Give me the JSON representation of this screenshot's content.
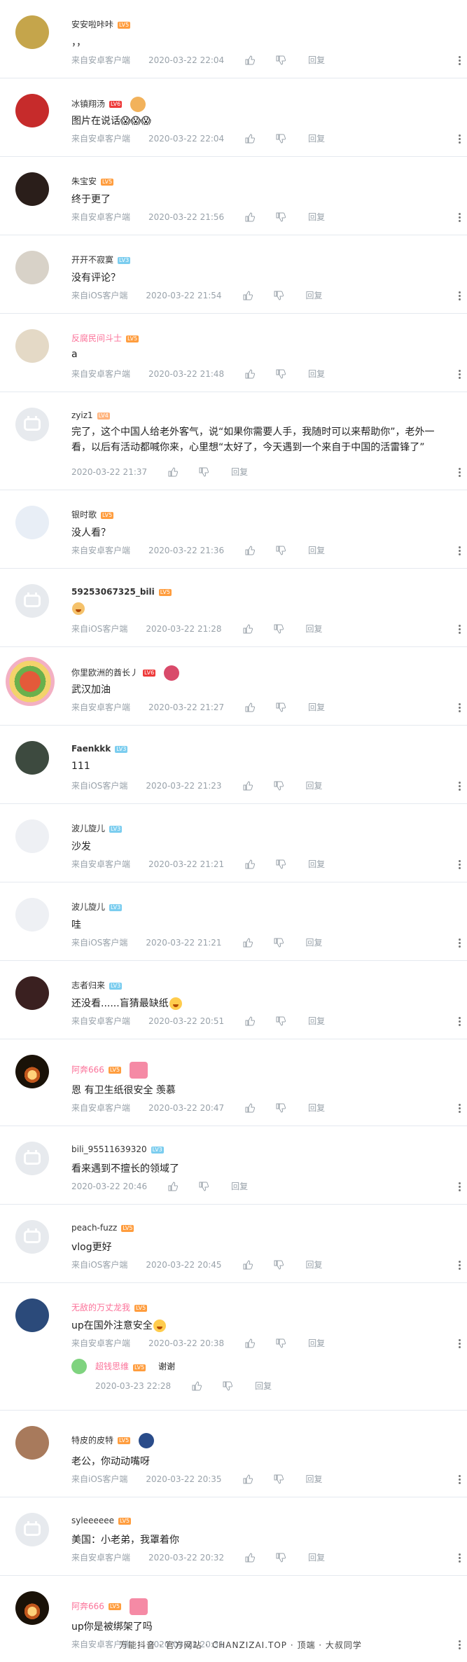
{
  "labels": {
    "reply": "回复"
  },
  "comments": [
    {
      "user": "安安啦咔咔",
      "level": "LV5",
      "text": "，，",
      "source": "来自安卓客户端",
      "time": "2020-03-22 22:04"
    },
    {
      "user": "冰镇翔汤",
      "level": "LV6",
      "text": "图片在说话😱😱😱",
      "source": "来自安卓客户端",
      "time": "2020-03-22 22:04"
    },
    {
      "user": "朱宝安",
      "level": "LV5",
      "text": "终于更了",
      "source": "来自安卓客户端",
      "time": "2020-03-22 21:56"
    },
    {
      "user": "开开不寂寞",
      "level": "LV3",
      "text": "没有评论？",
      "source": "来自iOS客户端",
      "time": "2020-03-22 21:54"
    },
    {
      "user": "反腐民间斗士",
      "level": "LV5",
      "text": "a",
      "source": "来自安卓客户端",
      "time": "2020-03-22 21:48"
    },
    {
      "user": "zyiz1",
      "level": "LV4",
      "text": "完了，这个中国人给老外客气，说“如果你需要人手，我随时可以来帮助你”，老外一看，以后有活动都喊你来，心里想“太好了，今天遇到一个来自于中国的活雷锋了”",
      "source": "",
      "time": "2020-03-22 21:37"
    },
    {
      "user": "银时歌",
      "level": "LV5",
      "text": "没人看？",
      "source": "来自安卓客户端",
      "time": "2020-03-22 21:36"
    },
    {
      "user": "59253067325_bili",
      "level": "LV5",
      "text": "",
      "source": "来自iOS客户端",
      "time": "2020-03-22 21:28"
    },
    {
      "user": "你里欧洲的酋长丿",
      "level": "LV6",
      "text": "武汉加油",
      "source": "来自安卓客户端",
      "time": "2020-03-22 21:27"
    },
    {
      "user": "Faenkkk",
      "level": "LV3",
      "text": "111",
      "source": "来自iOS客户端",
      "time": "2020-03-22 21:23"
    },
    {
      "user": "波儿旋儿",
      "level": "LV3",
      "text": "沙发",
      "source": "来自安卓客户端",
      "time": "2020-03-22 21:21"
    },
    {
      "user": "波儿旋儿",
      "level": "LV3",
      "text": "哇",
      "source": "来自iOS客户端",
      "time": "2020-03-22 21:21"
    },
    {
      "user": "志者归来",
      "level": "LV3",
      "text": "还没看......盲猜最缺纸",
      "source": "来自安卓客户端",
      "time": "2020-03-22 20:51"
    },
    {
      "user": "阿奔666",
      "level": "LV5",
      "text": "恩 有卫生纸很安全 羡慕",
      "source": "来自安卓客户端",
      "time": "2020-03-22 20:47"
    },
    {
      "user": "bili_95511639320",
      "level": "LV3",
      "text": "看来遇到不擅长的领域了",
      "source": "",
      "time": "2020-03-22 20:46"
    },
    {
      "user": "peach-fuzz",
      "level": "LV5",
      "text": "vlog更好",
      "source": "来自iOS客户端",
      "time": "2020-03-22 20:45"
    },
    {
      "user": "无敌的万丈龙我",
      "level": "LV5",
      "text": "up在国外注意安全",
      "source": "来自安卓客户端",
      "time": "2020-03-22 20:38"
    },
    {
      "user": "特皮的皮特",
      "level": "LV5",
      "text": "老公，你动动嘴呀",
      "source": "来自iOS客户端",
      "time": "2020-03-22 20:35"
    },
    {
      "user": "syleeeeee",
      "level": "LV5",
      "text": "美国：小老弟，我罩着你",
      "source": "来自安卓客户端",
      "time": "2020-03-22 20:32"
    },
    {
      "user": "阿奔666",
      "level": "LV5",
      "text": "up你是被绑架了吗",
      "source": "来自安卓客户端",
      "time": "2020-03-22 20:31"
    }
  ],
  "subreply": {
    "user": "超钱思维",
    "level": "LV5",
    "text": "谢谢",
    "time": "2020-03-23 22:28"
  },
  "footer_overlay": "万能抖音 · 官方网站 · CHANZIZAI.TOP · 顶端 · 大叔同学"
}
